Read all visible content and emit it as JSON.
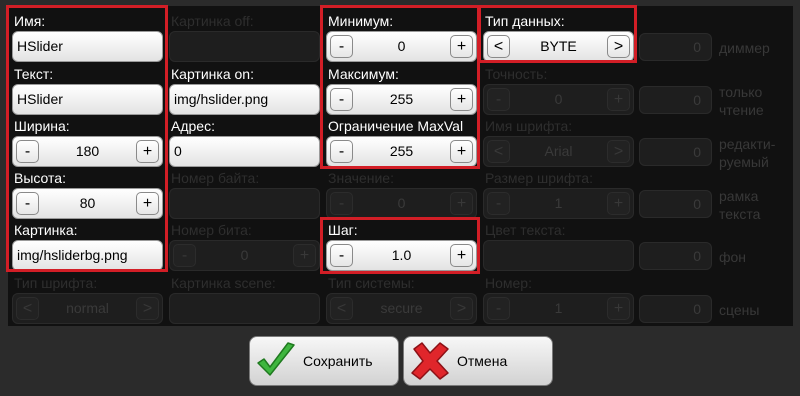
{
  "left": {
    "name_label": "Имя:",
    "name_value": "HSlider",
    "text_label": "Текст:",
    "text_value": "HSlider",
    "width_label": "Ширина:",
    "width_value": "180",
    "height_label": "Высота:",
    "height_value": "80",
    "image_label": "Картинка:",
    "image_value": "img/hsliderbg.png",
    "font_type_label": "Тип шрифта:",
    "font_type_value": "normal"
  },
  "col2": {
    "image_off_label": "Картинка off:",
    "image_on_label": "Картинка on:",
    "image_on_value": "img/hslider.png",
    "address_label": "Адрес:",
    "address_value": "0",
    "byte_number_label": "Номер байта:",
    "bit_number_label": "Номер бита:",
    "bit_number_value": "0",
    "scene_image_label": "Картинка scene:"
  },
  "col3": {
    "min_label": "Минимум:",
    "min_value": "0",
    "max_label": "Максимум:",
    "max_value": "255",
    "maxval_label": "Ограничение MaxVal",
    "maxval_value": "255",
    "value_label": "Значение:",
    "value_value": "0",
    "step_label": "Шаг:",
    "step_value": "1.0",
    "system_type_label": "Тип системы:",
    "system_type_value": "secure"
  },
  "col4": {
    "data_type_label": "Тип данных:",
    "data_type_value": "BYTE",
    "precision_label": "Точность:",
    "precision_value": "0",
    "font_name_label": "Имя шрифта:",
    "font_name_value": "Arial",
    "font_size_label": "Размер шрифта:",
    "font_size_value": "1",
    "text_color_label": "Цвет текста:",
    "number_label": "Номер:",
    "number_value": "1"
  },
  "col5": {
    "dimmer_value": "0",
    "dimmer_label": "диммер",
    "readonly_value": "0",
    "readonly_label": "только чтение",
    "editable_value": "0",
    "editable_label": "редакти-руемый",
    "frame_value": "0",
    "frame_label": "рамка текста",
    "bg_value": "0",
    "bg_label": "фон",
    "scenes_value": "0",
    "scenes_label": "сцены"
  },
  "buttons": {
    "save": "Сохранить",
    "cancel": "Отмена"
  },
  "stepper": {
    "minus": "-",
    "plus": "+",
    "prev": "<",
    "next": ">"
  },
  "colors": {
    "highlight": "#d21e26",
    "panel": "#111111",
    "background": "#2b2b2b"
  }
}
